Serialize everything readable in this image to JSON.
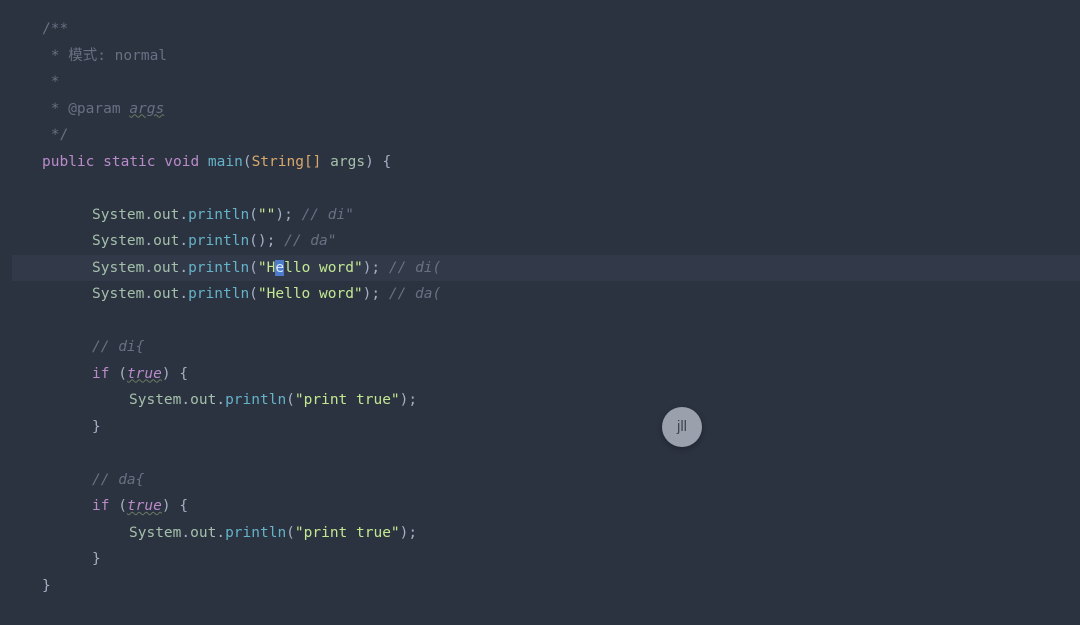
{
  "badge": {
    "label": "jll"
  },
  "comments": {
    "doc_open": "/**",
    "doc_mode": " * 模式: normal",
    "doc_blank": " *",
    "doc_param_prefix": " * @param ",
    "doc_param_name": "args",
    "doc_close": " */",
    "line_di_quote": " // di\"",
    "line_da_quote": " // da\"",
    "line_di_paren": " // di(",
    "line_da_paren": " // da(",
    "line_di_brace": "// di{",
    "line_da_brace": "// da{"
  },
  "kw": {
    "public": "public",
    "static": "static",
    "void": "void",
    "if": "if",
    "true": "true"
  },
  "ident": {
    "main": "main",
    "System": "System",
    "out": "out",
    "println": "println",
    "string_arr": "String[]",
    "args": "args"
  },
  "punct": {
    "brace_open_main": " {",
    "brace_open": ") {",
    "brace_close": "}",
    "semicolon": ";",
    "dot": "."
  },
  "strings": {
    "empty": "\"\"",
    "hello_pre": "\"H",
    "cursor_char": "e",
    "hello_post": "llo word\"",
    "hello_full": "\"Hello word\"",
    "print_true": "\"print true\""
  }
}
